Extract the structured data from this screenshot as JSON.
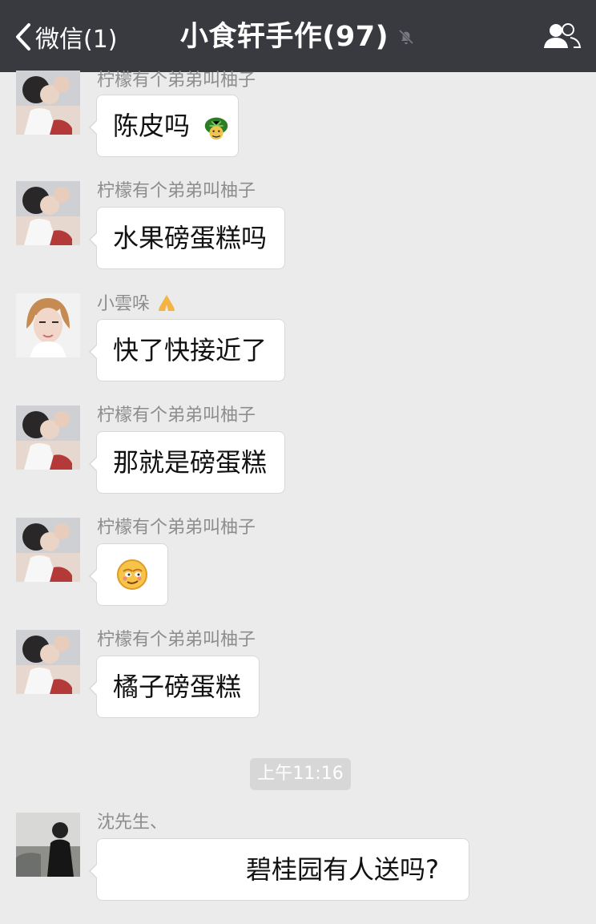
{
  "header": {
    "back_label": "微信(1)",
    "title": "小食轩手作(97)"
  },
  "messages": [
    {
      "sender": "柠檬有个弟弟叫柚子",
      "text": "陈皮吗"
    },
    {
      "sender": "柠檬有个弟弟叫柚子",
      "text": "水果磅蛋糕吗"
    },
    {
      "sender": "小雲哚",
      "text": "快了快接近了"
    },
    {
      "sender": "柠檬有个弟弟叫柚子",
      "text": "那就是磅蛋糕"
    },
    {
      "sender": "柠檬有个弟弟叫柚子",
      "text": ""
    },
    {
      "sender": "柠檬有个弟弟叫柚子",
      "text": "橘子磅蛋糕"
    },
    {
      "sender": "沈先生、",
      "text": "碧桂园有人送吗?"
    }
  ],
  "timestamp": "上午11:16",
  "icons": {
    "back": "chevron-left-icon",
    "mute": "muted-bell-icon",
    "group": "group-members-icon",
    "turtle": "turtle-emoji-icon",
    "prayer": "folded-hands-emoji-icon",
    "smile": "smirk-face-emoji-icon"
  },
  "colors": {
    "nav_bg": "#393a3f",
    "chat_bg": "#ebebeb",
    "bubble_bg": "#ffffff",
    "sender_text": "#8d8d8d"
  }
}
